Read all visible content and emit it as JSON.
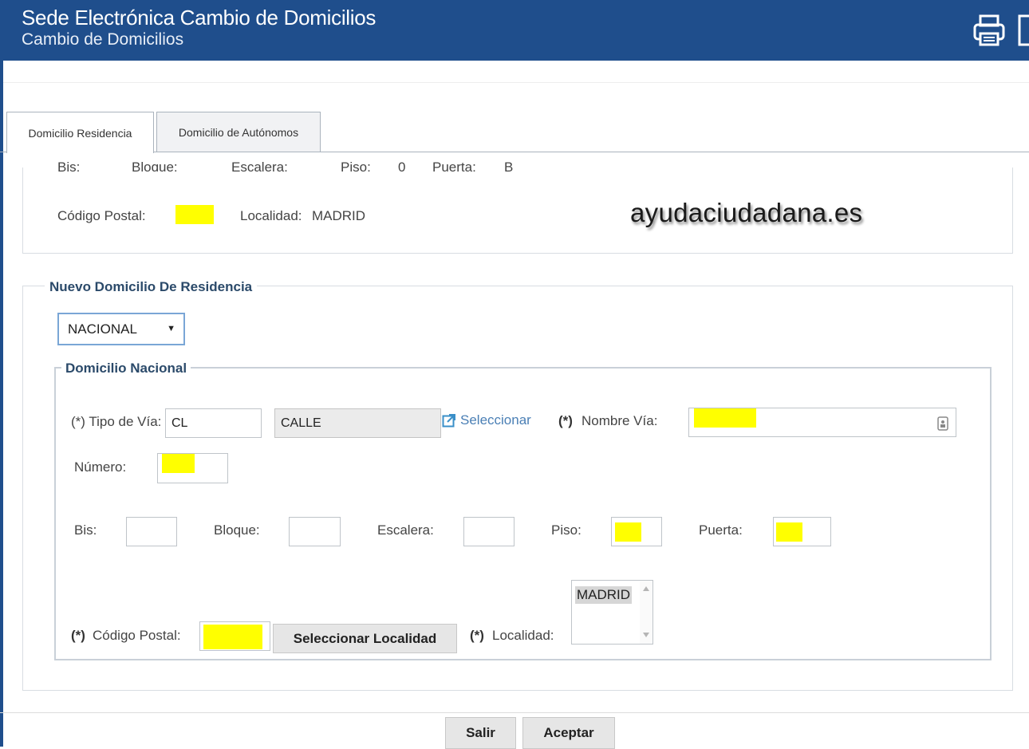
{
  "header": {
    "title": "Sede Electrónica Cambio de Domicilios",
    "subtitle": "Cambio de Domicilios",
    "icons": [
      "printer-icon",
      "document-icon"
    ]
  },
  "tabs": [
    {
      "label": "Domicilio Residencia",
      "active": true
    },
    {
      "label": "Domicilio de Autónomos",
      "active": false
    }
  ],
  "old_address": {
    "cut_labels": [
      "Bis:",
      "Bloque:",
      "Escalera:",
      "Piso:",
      "0",
      "Puerta:",
      "B"
    ],
    "postal_code_label": "Código Postal:",
    "localidad_label": "Localidad:",
    "localidad_value": "MADRID"
  },
  "watermark": "ayudaciudadana.es",
  "new_address": {
    "legend": "Nuevo Domicilio De Residencia",
    "country_select": "NACIONAL",
    "nacional_legend": "Domicilio Nacional",
    "tipo_via_label": "(*) Tipo de Vía:",
    "tipo_via_code": "CL",
    "tipo_via_name": "CALLE",
    "seleccionar_link": "Seleccionar",
    "nombre_via_req": "(*)",
    "nombre_via_label": "Nombre Vía:",
    "numero_label": "Número:",
    "bis_label": "Bis:",
    "bloque_label": "Bloque:",
    "escalera_label": "Escalera:",
    "piso_label": "Piso:",
    "puerta_label": "Puerta:",
    "codigo_postal_req": "(*)",
    "codigo_postal_label": "Código Postal:",
    "seleccionar_localidad_button": "Seleccionar Localidad",
    "localidad_req": "(*)",
    "localidad_label": "Localidad:",
    "localidad_options": [
      "MADRID"
    ]
  },
  "footer": {
    "salir_button": "Salir",
    "aceptar_button": "Aceptar"
  },
  "colors": {
    "header_bg": "#1f4e8c",
    "legend_text": "#2b4a6a",
    "link": "#4a7fb5",
    "redaction": "#ffff00"
  }
}
